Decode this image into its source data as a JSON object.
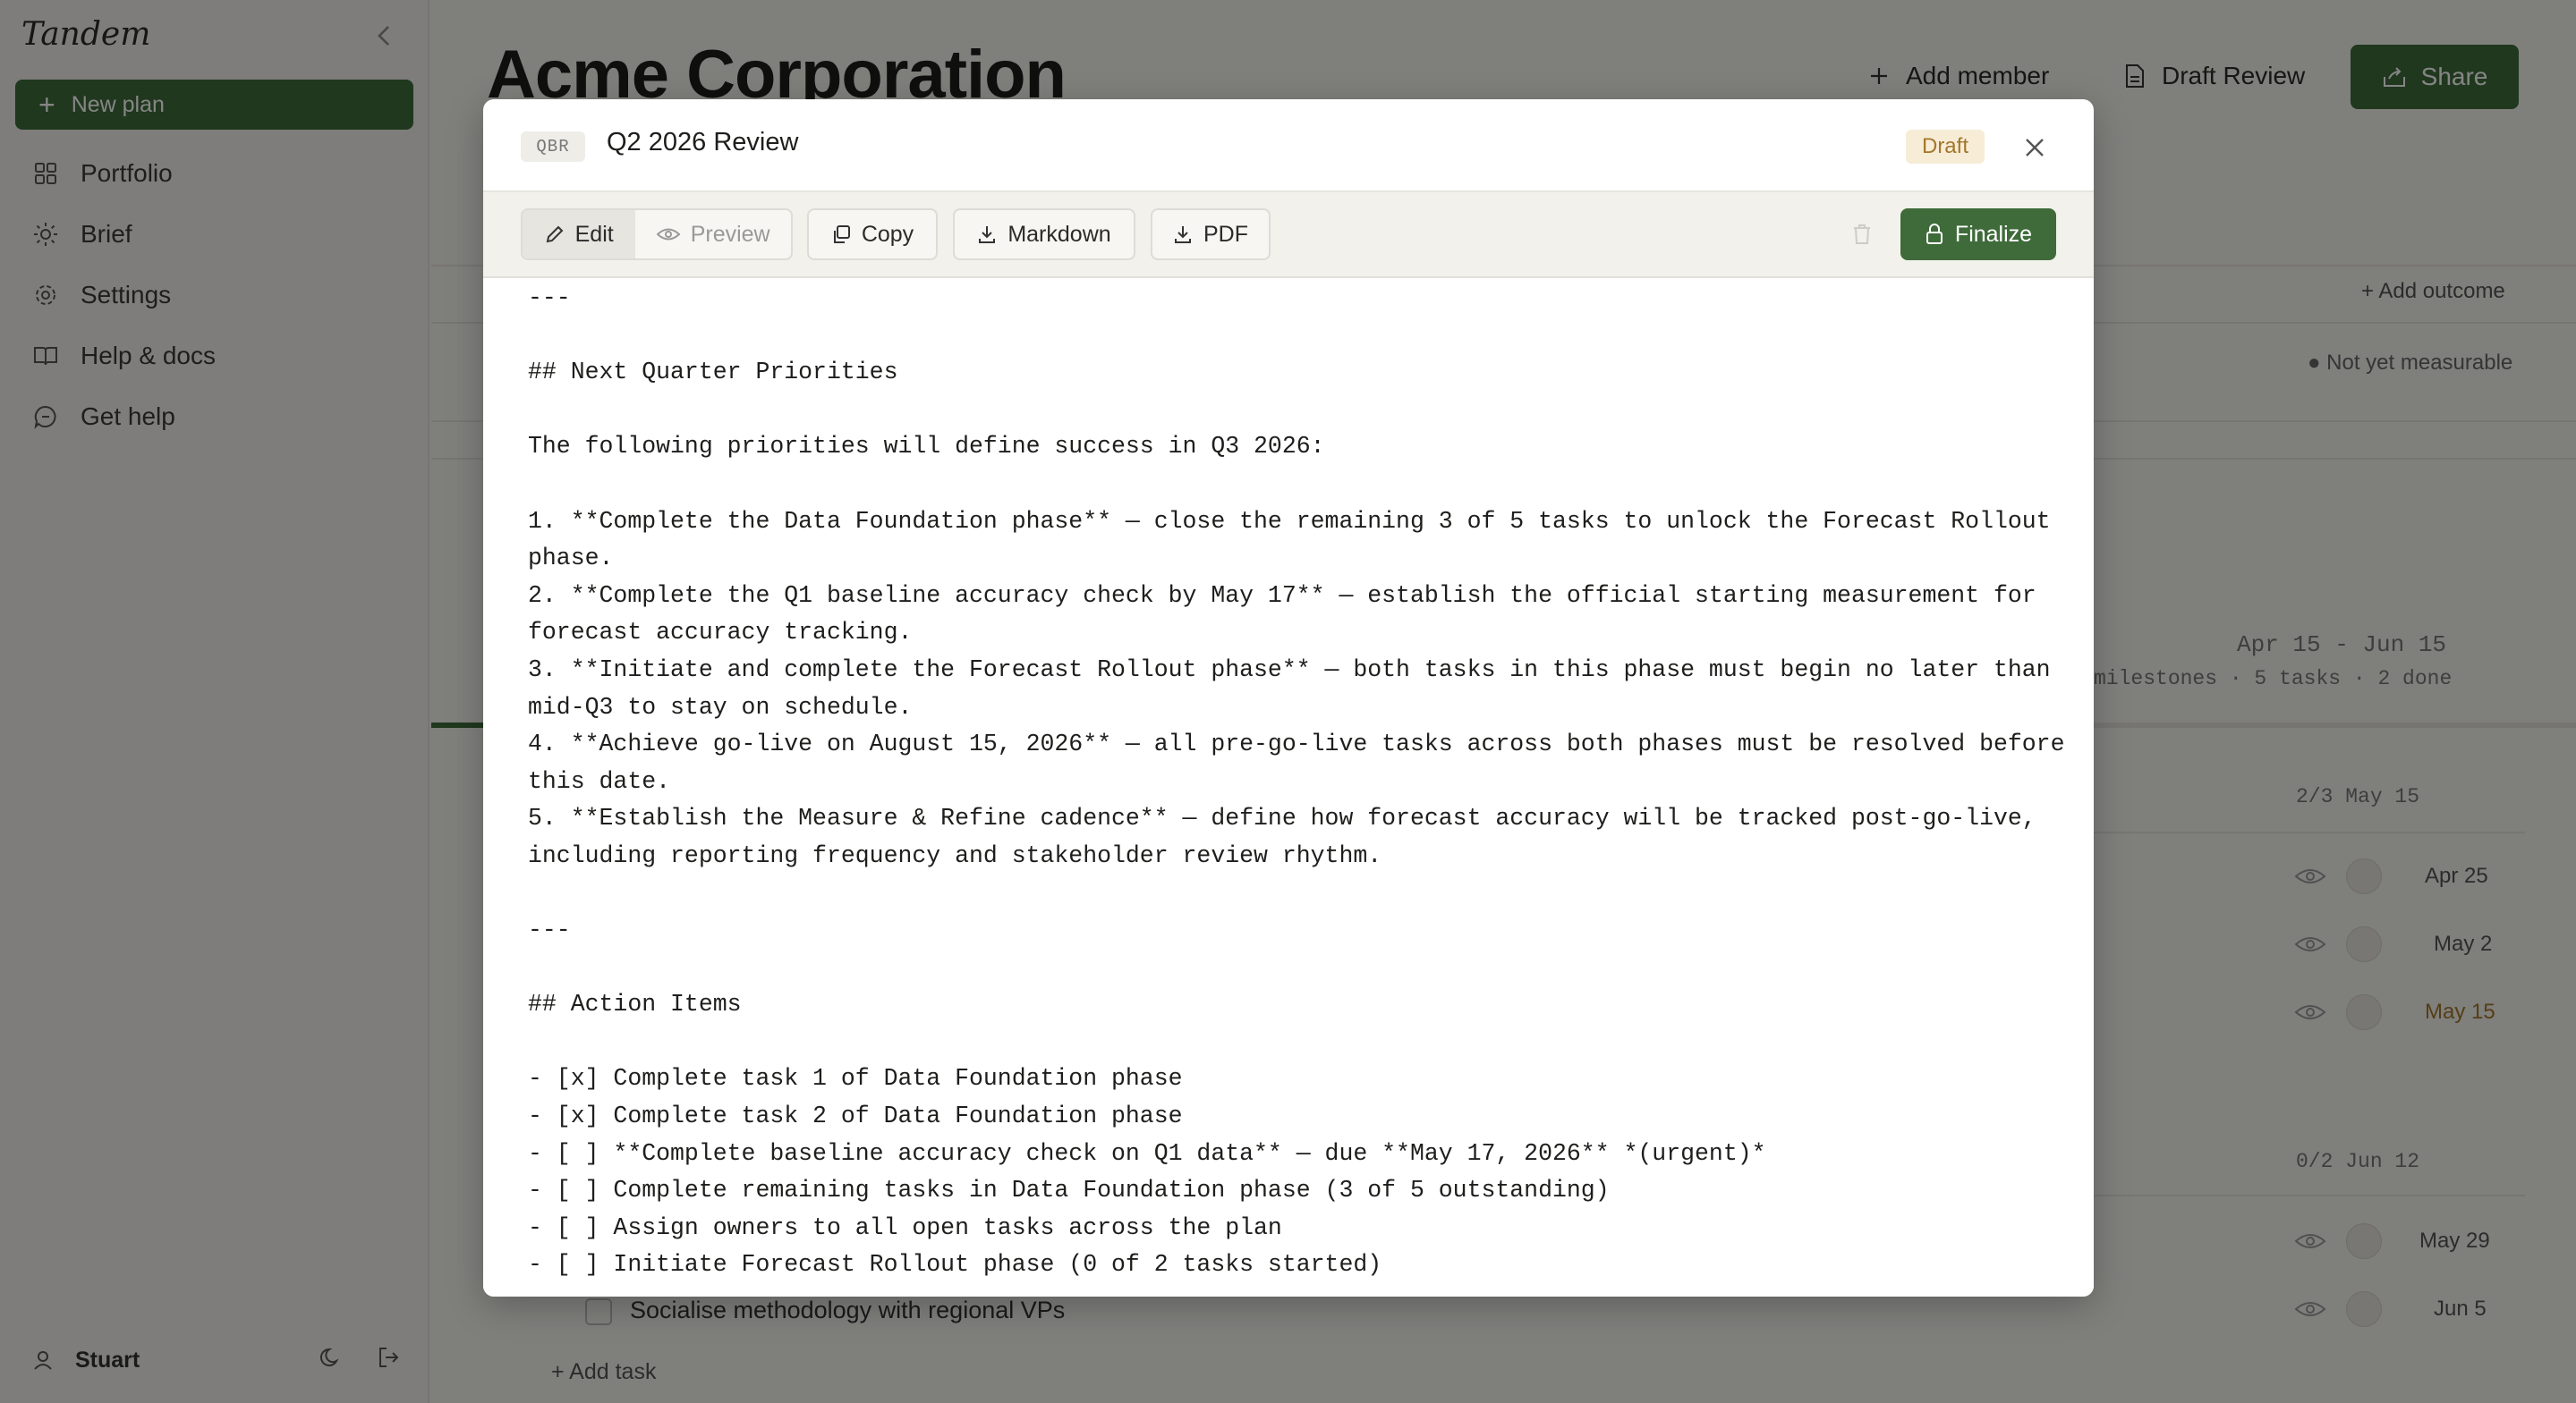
{
  "sidebar": {
    "brand": "Tandem",
    "new_plan_label": "New plan",
    "nav": [
      {
        "label": "Portfolio",
        "icon": "grid-icon"
      },
      {
        "label": "Brief",
        "icon": "sun-icon"
      },
      {
        "label": "Settings",
        "icon": "gear-icon"
      },
      {
        "label": "Help & docs",
        "icon": "book-icon"
      },
      {
        "label": "Get help",
        "icon": "chat-icon"
      }
    ],
    "user_name": "Stuart"
  },
  "main": {
    "title": "Acme Corporation",
    "add_member_label": "Add member",
    "draft_review_label": "Draft Review",
    "share_label": "Share",
    "add_outcome_label": "Add outcome",
    "not_measurable_label": "● Not yet measurable",
    "phase_dates": "Apr 15 - Jun 15",
    "phase_summary": "milestones · 5 tasks · 2 done",
    "milestone_1": "2/3  May 15",
    "dates_1": [
      "Apr 25",
      "May 2",
      "May 15"
    ],
    "milestone_2": "0/2  Jun 12",
    "dates_2": [
      "May 29",
      "Jun 5"
    ],
    "task_visible": "Socialise methodology with regional VPs",
    "add_task_label": "Add task"
  },
  "modal": {
    "tag": "QBR",
    "title": "Q2 2026 Review",
    "status": "Draft",
    "toolbar": {
      "edit": "Edit",
      "preview": "Preview",
      "copy": "Copy",
      "markdown": "Markdown",
      "pdf": "PDF",
      "finalize": "Finalize"
    },
    "content_lines": [
      "---",
      "",
      "## Next Quarter Priorities",
      "",
      "The following priorities will define success in Q3 2026:",
      "",
      "1. **Complete the Data Foundation phase** — close the remaining 3 of 5 tasks to unlock the Forecast Rollout",
      "phase.",
      "2. **Complete the Q1 baseline accuracy check by May 17** — establish the official starting measurement for",
      "forecast accuracy tracking.",
      "3. **Initiate and complete the Forecast Rollout phase** — both tasks in this phase must begin no later than",
      "mid-Q3 to stay on schedule.",
      "4. **Achieve go-live on August 15, 2026** — all pre-go-live tasks across both phases must be resolved before",
      "this date.",
      "5. **Establish the Measure & Refine cadence** — define how forecast accuracy will be tracked post-go-live,",
      "including reporting frequency and stakeholder review rhythm.",
      "",
      "---",
      "",
      "## Action Items",
      "",
      "- [x] Complete task 1 of Data Foundation phase",
      "- [x] Complete task 2 of Data Foundation phase",
      "- [ ] **Complete baseline accuracy check on Q1 data** — due **May 17, 2026** *(urgent)*",
      "- [ ] Complete remaining tasks in Data Foundation phase (3 of 5 outstanding)",
      "- [ ] Assign owners to all open tasks across the plan",
      "- [ ] Initiate Forecast Rollout phase (0 of 2 tasks started)"
    ]
  },
  "colors": {
    "accent": "#3f6b3a",
    "draft_badge_bg": "#f7ecd6",
    "draft_badge_text": "#a3772a",
    "overlay": "rgba(0,0,0,0.48)"
  }
}
